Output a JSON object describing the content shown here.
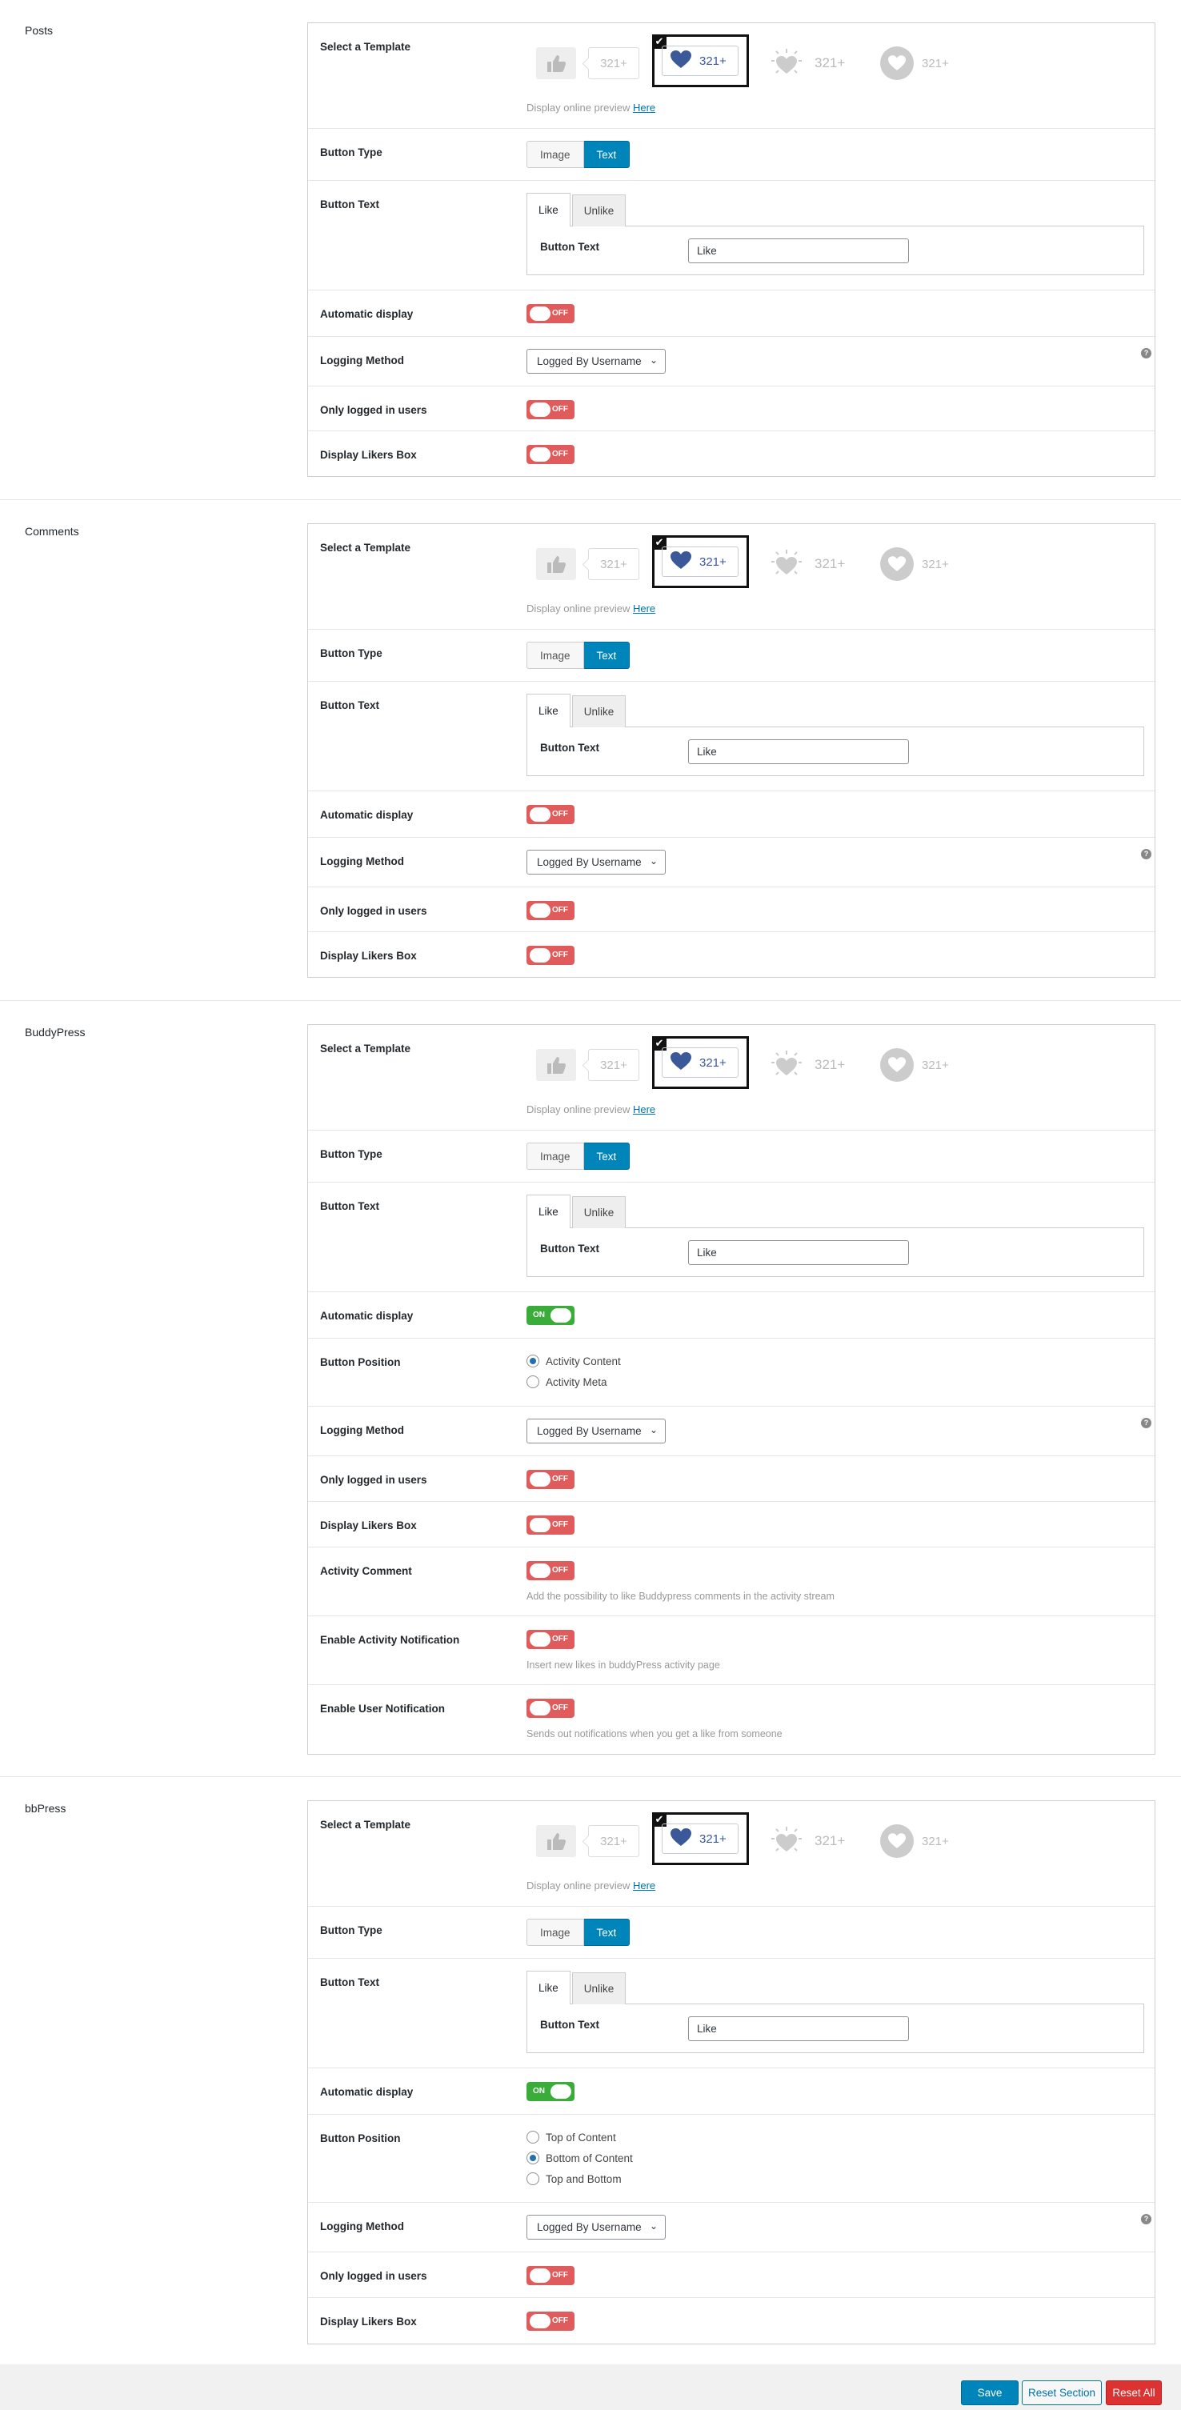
{
  "common": {
    "select_template_label": "Select a Template",
    "preview_text": "Display online preview",
    "preview_link": "Here",
    "counter": "321+",
    "button_type_label": "Button Type",
    "button_type_image": "Image",
    "button_type_text": "Text",
    "button_text_label": "Button Text",
    "tab_like": "Like",
    "tab_unlike": "Unlike",
    "button_text_field_label": "Button Text",
    "button_text_value": "Like",
    "automatic_display_label": "Automatic display",
    "logging_method_label": "Logging Method",
    "logging_method_value": "Logged By Username",
    "only_logged_label": "Only logged in users",
    "likers_box_label": "Display Likers Box",
    "button_position_label": "Button Position",
    "toggle_on": "ON",
    "toggle_off": "OFF"
  },
  "sections": {
    "posts": {
      "title": "Posts",
      "automatic_display": "OFF",
      "only_logged": "OFF",
      "likers_box": "OFF"
    },
    "comments": {
      "title": "Comments",
      "automatic_display": "OFF",
      "only_logged": "OFF",
      "likers_box": "OFF"
    },
    "buddypress": {
      "title": "BuddyPress",
      "automatic_display": "ON",
      "position_options": [
        "Activity Content",
        "Activity Meta"
      ],
      "position_selected": 0,
      "only_logged": "OFF",
      "likers_box": "OFF",
      "activity_comment_label": "Activity Comment",
      "activity_comment": "OFF",
      "activity_comment_desc": "Add the possibility to like Buddypress comments in the activity stream",
      "activity_notification_label": "Enable Activity Notification",
      "activity_notification": "OFF",
      "activity_notification_desc": "Insert new likes in buddyPress activity page",
      "user_notification_label": "Enable User Notification",
      "user_notification": "OFF",
      "user_notification_desc": "Sends out notifications when you get a like from someone"
    },
    "bbpress": {
      "title": "bbPress",
      "automatic_display": "ON",
      "position_options": [
        "Top of Content",
        "Bottom of Content",
        "Top and Bottom"
      ],
      "position_selected": 1,
      "only_logged": "OFF",
      "likers_box": "OFF"
    }
  },
  "footer": {
    "save": "Save",
    "reset_section": "Reset Section",
    "reset_all": "Reset All"
  },
  "colors": {
    "primary": "#0085ba",
    "toggle_off": "#e05b5b",
    "toggle_on": "#3aac3a",
    "danger": "#dc3232",
    "facebook_blue": "#3b5998"
  }
}
